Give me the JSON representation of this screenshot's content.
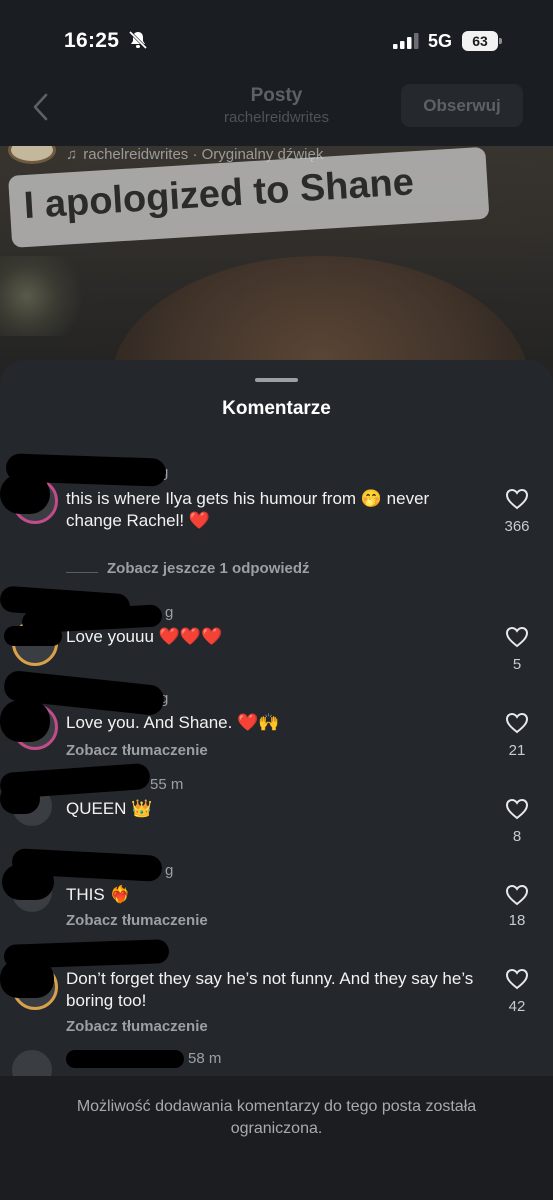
{
  "status_bar": {
    "time": "16:25",
    "network": "5G",
    "battery": "63"
  },
  "nav": {
    "title": "Posty",
    "subtitle": "rachelreidwrites",
    "follow_label": "Obserwuj"
  },
  "video": {
    "audio_line": "rachelreidwrites · Oryginalny dźwięk",
    "caption": "I apologized to Shane"
  },
  "sheet": {
    "title": "Komentarze"
  },
  "comments": [
    {
      "meta": "g",
      "text": "this is where Ilya gets his humour from 🤭 never change Rachel! ❤️",
      "likes": "366"
    },
    {
      "meta": "7 1 g",
      "text": "Love youuu ❤️❤️❤️",
      "likes": "5"
    },
    {
      "meta": "g",
      "text": "Love you. And Shane. ❤️🙌",
      "translate": "Zobacz tłumaczenie",
      "likes": "21"
    },
    {
      "meta": "55 m",
      "text": "QUEEN 👑",
      "likes": "8"
    },
    {
      "meta": "g",
      "text": "THIS ❤️‍🔥",
      "translate": "Zobacz tłumaczenie",
      "likes": "18"
    },
    {
      "meta": "",
      "text": "Don’t forget they say he’s not funny. And they say he’s boring too!",
      "translate": "Zobacz tłumaczenie",
      "likes": "42"
    },
    {
      "meta": "58 m"
    }
  ],
  "replies_link": "Zobacz jeszcze 1 odpowiedź",
  "footer": {
    "notice": "Możliwość dodawania komentarzy do tego posta została ograniczona."
  },
  "colors": {
    "background": "#16181b",
    "sheet": "#24272b",
    "secondary_text": "#9ca0a5",
    "ring": "#c24b8a"
  },
  "icons": [
    "bell-muted-icon",
    "signal-icon",
    "battery-icon",
    "back-chevron-icon",
    "music-note-icon",
    "heart-outline-icon"
  ]
}
